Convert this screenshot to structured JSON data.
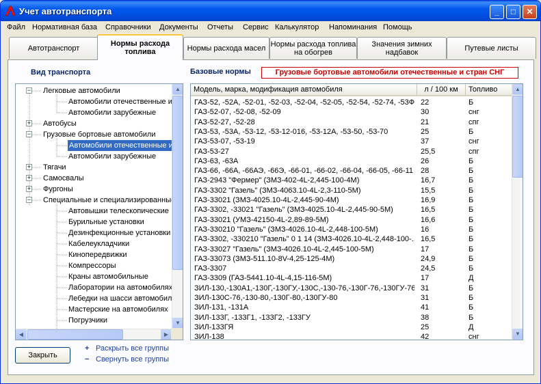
{
  "window": {
    "title": "Учет автотранспорта",
    "controls": {
      "minimize": "_",
      "maximize": "□",
      "close": "✕"
    },
    "accent": "#0058ee"
  },
  "menu": [
    "Файл",
    "Нормативная база",
    "Справочники",
    "Документы",
    "Отчеты",
    "Сервис",
    "Калькулятор",
    "Напоминания",
    "Помощь"
  ],
  "tabs": [
    {
      "label": "Автотранспорт",
      "active": false
    },
    {
      "label": "Нормы расхода топлива",
      "active": true
    },
    {
      "label": "Нормы расхода масел",
      "active": false
    },
    {
      "label": "Нормы расхода топлива на обогрев",
      "active": false
    },
    {
      "label": "Значения зимних надбавок",
      "active": false
    },
    {
      "label": "Путевые листы",
      "active": false
    }
  ],
  "left": {
    "title": "Вид транспорта",
    "tree": [
      {
        "label": "Легковые автомобили",
        "level": 0,
        "expander": "−"
      },
      {
        "label": "Автомобили отечественные и",
        "level": 1
      },
      {
        "label": "Автомобили зарубежные",
        "level": 1
      },
      {
        "label": "Автобусы",
        "level": 0,
        "expander": "+"
      },
      {
        "label": "Грузовые бортовые автомобили",
        "level": 0,
        "expander": "−"
      },
      {
        "label": "Автомобили отечественные и",
        "level": 1,
        "selected": true
      },
      {
        "label": "Автомобили зарубежные",
        "level": 1
      },
      {
        "label": "Тягачи",
        "level": 0,
        "expander": "+"
      },
      {
        "label": "Самосвалы",
        "level": 0,
        "expander": "+"
      },
      {
        "label": "Фургоны",
        "level": 0,
        "expander": "+"
      },
      {
        "label": "Специальные и специализированные",
        "level": 0,
        "expander": "−"
      },
      {
        "label": "Автовышки телескопические",
        "level": 1
      },
      {
        "label": "Бурильные установки",
        "level": 1
      },
      {
        "label": "Дезинфекционные установки",
        "level": 1
      },
      {
        "label": "Кабелеукладчики",
        "level": 1
      },
      {
        "label": "Кинопередвижки",
        "level": 1
      },
      {
        "label": "Компрессоры",
        "level": 1
      },
      {
        "label": "Краны автомобильные",
        "level": 1
      },
      {
        "label": "Лаборатории на автомобилях",
        "level": 1
      },
      {
        "label": "Лебедки на шасси автомобилей",
        "level": 1
      },
      {
        "label": "Мастерские на автомобилях",
        "level": 1
      },
      {
        "label": "Погрузчики",
        "level": 1
      }
    ],
    "buttons": {
      "close": "Закрыть"
    },
    "links": [
      {
        "symbol": "+",
        "label": "Раскрыть все группы"
      },
      {
        "symbol": "−",
        "label": "Свернуть все группы"
      }
    ]
  },
  "right": {
    "title": "Базовые нормы",
    "category": "Грузовые бортовые автомобили отечественные и стран СНГ",
    "columns": [
      "Модель, марка, модификация автомобиля",
      "л / 100 км",
      "Топливо"
    ],
    "rows": [
      [
        "ГАЗ-52, -52А, -52-01, -52-03, -52-04, -52-05, -52-54, -52-74, -53Ф",
        "22",
        "Б"
      ],
      [
        "ГАЗ-52-07, -52-08, -52-09",
        "30",
        "снг"
      ],
      [
        "ГАЗ-52-27, -52-28",
        "21",
        "спг"
      ],
      [
        "ГАЗ-53, -53А, -53-12, -53-12-016, -53-12А, -53-50, -53-70",
        "25",
        "Б"
      ],
      [
        "ГАЗ-53-07, -53-19",
        "37",
        "снг"
      ],
      [
        "ГАЗ-53-27",
        "25,5",
        "спг"
      ],
      [
        "ГАЗ-63, -63А",
        "26",
        "Б"
      ],
      [
        "ГАЗ-66, -66А, -66АЭ, -66Э, -66-01, -66-02, -66-04, -66-05, -66-11",
        "28",
        "Б"
      ],
      [
        "ГАЗ-2943 \"Фермер\" (ЗМЗ-402-4L-2,445-100-4М)",
        "16,7",
        "Б"
      ],
      [
        "ГАЗ-3302 \"Газель\" (ЗМЗ-4063.10-4L-2,3-110-5М)",
        "15,5",
        "Б"
      ],
      [
        "ГАЗ-33021 (ЗМЗ-4025.10-4L-2,445-90-4М)",
        "16,9",
        "Б"
      ],
      [
        "ГАЗ-3302, -33021 \"Газель\" (ЗМЗ-4025.10-4L-2,445-90-5М)",
        "16,5",
        "Б"
      ],
      [
        "ГАЗ-33021 (УМЗ-42150-4L-2,89-89-5М)",
        "16,6",
        "Б"
      ],
      [
        "ГАЗ-330210 \"Газель\" (ЗМЗ-4026.10-4L-2,448-100-5М)",
        "16",
        "Б"
      ],
      [
        "ГАЗ-3302, -330210 \"Газель\" 0 1 14 (ЗМЗ-4026.10-4L-2,448-100-...",
        "16,5",
        "Б"
      ],
      [
        "ГАЗ-33027 \"Газель\" (ЗМЗ-4026.10-4L-2,445-100-5М)",
        "17",
        "Б"
      ],
      [
        "ГАЗ-33073 (ЗМЗ-511.10-8V-4,25-125-4М)",
        "24,9",
        "Б"
      ],
      [
        "ГАЗ-3307",
        "24,5",
        "Б"
      ],
      [
        "ГАЗ-3309 (ГАЗ-5441.10-4L-4,15-116-5М)",
        "17",
        "Д"
      ],
      [
        "ЗИЛ-130,-130А1,-130Г,-130ГУ,-130С,-130-76,-130Г-76,-130ГУ-76",
        "31",
        "Б"
      ],
      [
        "ЗИЛ-130С-76,-130-80,-130Г-80,-130ГУ-80",
        "31",
        "Б"
      ],
      [
        "ЗИЛ-131, -131А",
        "41",
        "Б"
      ],
      [
        "ЗИЛ-133Г, -133Г1, -133Г2, -133ГУ",
        "38",
        "Б"
      ],
      [
        "ЗИЛ-133ГЯ",
        "25",
        "Д"
      ],
      [
        "ЗИЛ-138",
        "42",
        "снг"
      ]
    ]
  }
}
